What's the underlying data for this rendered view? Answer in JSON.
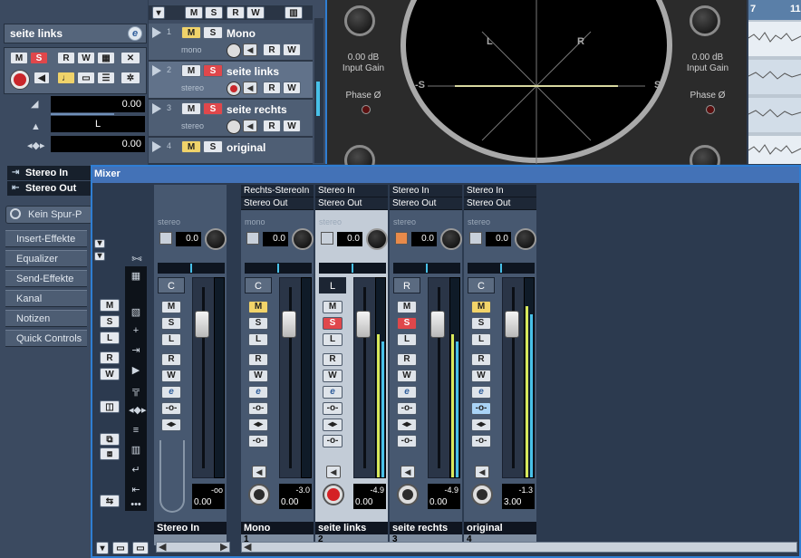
{
  "inspector": {
    "track_name": "seite links",
    "edit_glyph": "e",
    "buttons": {
      "m": "M",
      "s": "S",
      "r": "R",
      "w": "W"
    },
    "volume_value": "0.00",
    "pan_value": "L",
    "delay_value": "0.00",
    "input_label": "Stereo In",
    "output_label": "Stereo Out",
    "no_track_label": "Kein Spur-P",
    "sections": [
      "Insert-Effekte",
      "Equalizer",
      "Send-Effekte",
      "Kanal",
      "Notizen",
      "Quick Controls"
    ]
  },
  "tracklist": {
    "header_buttons": {
      "m": "M",
      "s": "S",
      "r": "R",
      "w": "W"
    },
    "tracks": [
      {
        "num": "1",
        "name": "Mono",
        "sub": "mono",
        "m": "M",
        "s": "S",
        "r": "R",
        "w": "W"
      },
      {
        "num": "2",
        "name": "seite links",
        "sub": "stereo",
        "m": "M",
        "s": "S",
        "r": "R",
        "w": "W"
      },
      {
        "num": "3",
        "name": "seite rechts",
        "sub": "stereo",
        "m": "M",
        "s": "S",
        "r": "R",
        "w": "W"
      },
      {
        "num": "4",
        "name": "original",
        "sub": "",
        "m": "M",
        "s": "S",
        "r": "R",
        "w": "W"
      }
    ]
  },
  "scope": {
    "left_gain": "0.00 dB",
    "right_gain": "0.00 dB",
    "input_gain_label": "Input Gain",
    "phase_label": "Phase Ø",
    "axis_L": "L",
    "axis_R": "R",
    "axis_minus_S": "-S",
    "axis_S": "S"
  },
  "arrange": {
    "ruler": [
      "7",
      "11"
    ]
  },
  "mixer": {
    "title": "Mixer",
    "common": {
      "m": "M",
      "s": "S",
      "l": "L",
      "r": "R",
      "w": "W"
    },
    "strips": [
      {
        "id": "stereo-in",
        "input": "",
        "output": "",
        "type": "stereo",
        "pan_num": "0.0",
        "lr": "C",
        "m": "M",
        "s": "S",
        "l": "L",
        "r": "R",
        "w": "W",
        "e": "e",
        "peak": "-oo",
        "vol": "0.00",
        "name": "Stereo In",
        "num": "",
        "meter_level": 0
      },
      {
        "id": "mono",
        "input": "Rechts-StereoIn",
        "output": "Stereo Out",
        "type": "mono",
        "pan_num": "0.0",
        "lr": "C",
        "m": "M",
        "s": "S",
        "l": "L",
        "r": "R",
        "w": "W",
        "e": "e",
        "peak": "-3.0",
        "vol": "0.00",
        "name": "Mono",
        "num": "1",
        "meter_level": 0
      },
      {
        "id": "seite-links",
        "input": "Stereo In",
        "output": "Stereo Out",
        "type": "stereo",
        "pan_num": "0.0",
        "lr": "L",
        "m": "M",
        "s": "S",
        "l": "L",
        "r": "R",
        "w": "W",
        "e": "e",
        "peak": "-4.9",
        "vol": "0.00",
        "name": "seite links",
        "num": "2",
        "meter_level": 0.72
      },
      {
        "id": "seite-rechts",
        "input": "Stereo In",
        "output": "Stereo Out",
        "type": "stereo",
        "pan_num": "0.0",
        "lr": "R",
        "m": "M",
        "s": "S",
        "l": "L",
        "r": "R",
        "w": "W",
        "e": "e",
        "peak": "-4.9",
        "vol": "0.00",
        "name": "seite rechts",
        "num": "3",
        "meter_level": 0.72
      },
      {
        "id": "original",
        "input": "Stereo In",
        "output": "Stereo Out",
        "type": "stereo",
        "pan_num": "0.0",
        "lr": "C",
        "m": "M",
        "s": "S",
        "l": "L",
        "r": "R",
        "w": "W",
        "e": "e",
        "peak": "-1.3",
        "vol": "3.00",
        "name": "original",
        "num": "4",
        "meter_level": 0.86
      }
    ]
  },
  "colors": {
    "accent": "#2f7ed3",
    "mute": "#f2d469",
    "solo": "#e0474b",
    "meter": "#d8e85a"
  }
}
